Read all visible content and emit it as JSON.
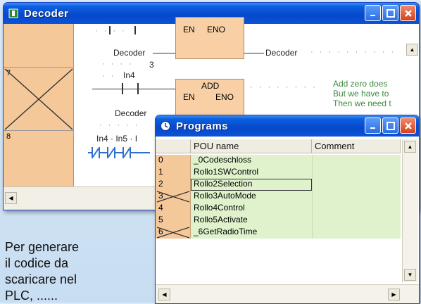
{
  "decoder_window": {
    "title": "Decoder",
    "rows": [
      {
        "number": "",
        "labels": {
          "contact_in": "Decoder",
          "contact_in_val": "3",
          "contact_out": "Decoder",
          "en": "EN",
          "eno": "ENO"
        }
      },
      {
        "number": "7",
        "labels": {
          "contact": "In4",
          "func": "ADD",
          "en": "EN",
          "eno": "ENO",
          "input": "Decoder"
        }
      },
      {
        "number": "8",
        "labels": {
          "contacts": "In4 · In5 · I"
        }
      }
    ],
    "comment_lines": [
      "Add zero does",
      "But we have to",
      "Then we need t"
    ]
  },
  "programs_window": {
    "title": "Programs",
    "columns": [
      "POU name",
      "Comment"
    ],
    "rows": [
      {
        "num": "0",
        "name": "_0Codeschloss",
        "crossed": false,
        "selected": false
      },
      {
        "num": "1",
        "name": "Rollo1SWControl",
        "crossed": false,
        "selected": false
      },
      {
        "num": "2",
        "name": "Rollo2Selection",
        "crossed": false,
        "selected": true
      },
      {
        "num": "3",
        "name": "Rollo3AutoMode",
        "crossed": true,
        "selected": false
      },
      {
        "num": "4",
        "name": "Rollo4Control",
        "crossed": false,
        "selected": false
      },
      {
        "num": "5",
        "name": "Rollo5Activate",
        "crossed": false,
        "selected": false
      },
      {
        "num": "6",
        "name": "_6GetRadioTime",
        "crossed": true,
        "selected": false
      }
    ]
  },
  "caption": {
    "lines": [
      "Per generare",
      "il codice da",
      "scaricare nel",
      "PLC, ......"
    ]
  },
  "colors": {
    "titlebar": "#0848c9",
    "row_header": "#f5c89a",
    "pou_row": "#dff2cc",
    "comment_text": "#3a8b3a"
  }
}
